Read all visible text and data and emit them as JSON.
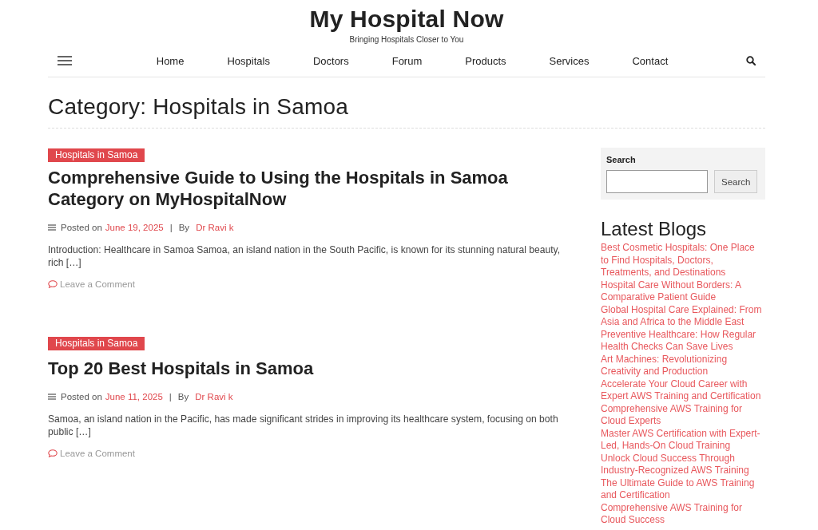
{
  "site": {
    "title": "My Hospital Now",
    "tagline": "Bringing Hospitals Closer to You"
  },
  "nav": {
    "items": [
      "Home",
      "Hospitals",
      "Doctors",
      "Forum",
      "Products",
      "Services",
      "Contact"
    ]
  },
  "page_title": "Category: Hospitals in Samoa",
  "posts": [
    {
      "category": "Hospitals in Samoa",
      "title": "Comprehensive Guide to Using the Hospitals in Samoa Category on MyHospitalNow",
      "posted_label": "Posted on",
      "date": "June 19, 2025",
      "separator": "|",
      "by_label": "By",
      "author": "Dr Ravi k",
      "excerpt": "Introduction: Healthcare in Samoa Samoa, an island nation in the South Pacific, is known for its stunning natural beauty, rich […]",
      "comment_link": "Leave a Comment"
    },
    {
      "category": "Hospitals in Samoa",
      "title": "Top 20 Best Hospitals in Samoa",
      "posted_label": "Posted on",
      "date": "June 11, 2025",
      "separator": "|",
      "by_label": "By",
      "author": "Dr Ravi k",
      "excerpt": "Samoa, an island nation in the Pacific, has made significant strides in improving its healthcare system, focusing on both public […]",
      "comment_link": "Leave a Comment"
    }
  ],
  "sidebar": {
    "search": {
      "label": "Search",
      "button": "Search"
    },
    "latest_blogs": {
      "heading": "Latest Blogs",
      "items": [
        "Best Cosmetic Hospitals: One Place to Find Hospitals, Doctors, Treatments, and Destinations",
        "Hospital Care Without Borders: A Comparative Patient Guide",
        "Global Hospital Care Explained: From Asia and Africa to the Middle East",
        "Preventive Healthcare: How Regular Health Checks Can Save Lives",
        "Art Machines: Revolutionizing Creativity and Production",
        "Accelerate Your Cloud Career with Expert AWS Training and Certification",
        "Comprehensive AWS Training for Cloud Experts",
        "Master AWS Certification with Expert-Led, Hands-On Cloud Training",
        "Unlock Cloud Success Through Industry-Recognized AWS Training",
        "The Ultimate Guide to AWS Training and Certification",
        "Comprehensive AWS Training for Cloud Success"
      ]
    }
  }
}
